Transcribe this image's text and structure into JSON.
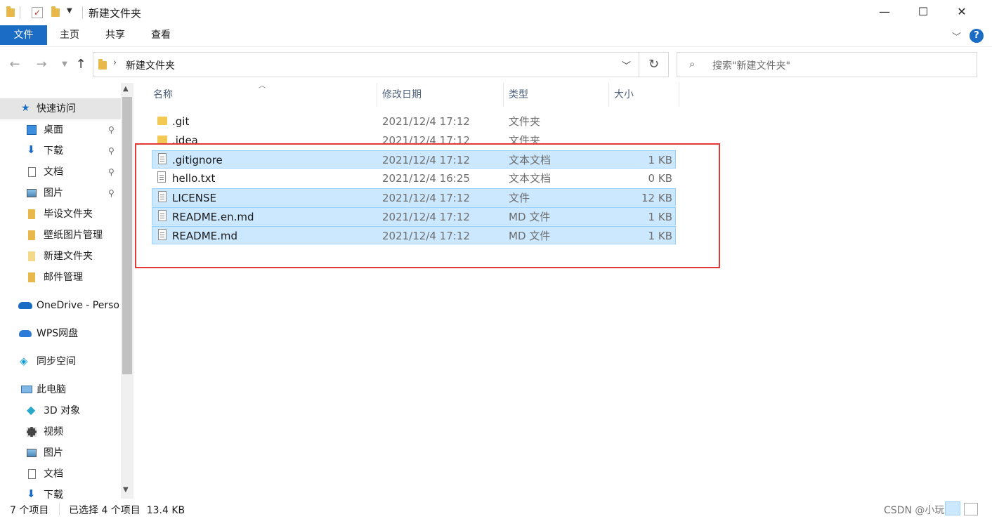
{
  "window": {
    "title": "新建文件夹",
    "controls": {
      "minimize": "—",
      "maximize": "☐",
      "close": "✕"
    }
  },
  "ribbon": {
    "tabs": [
      "文件",
      "主页",
      "共享",
      "查看"
    ],
    "help": "?"
  },
  "address": {
    "path": "新建文件夹",
    "search_placeholder": "搜索\"新建文件夹\""
  },
  "sidebar": {
    "items": [
      {
        "label": "快速访问",
        "icon": "star-icon",
        "selected": true
      },
      {
        "label": "桌面",
        "icon": "desktop-icon",
        "pinned": true
      },
      {
        "label": "下载",
        "icon": "download-icon",
        "pinned": true
      },
      {
        "label": "文档",
        "icon": "document-icon",
        "pinned": true
      },
      {
        "label": "图片",
        "icon": "picture-icon",
        "pinned": true
      },
      {
        "label": "毕设文件夹",
        "icon": "folder-icon"
      },
      {
        "label": "壁纸图片管理",
        "icon": "folder-icon"
      },
      {
        "label": "新建文件夹",
        "icon": "folder-icon"
      },
      {
        "label": "邮件管理",
        "icon": "folder-icon"
      },
      {
        "label": "OneDrive - Perso",
        "icon": "cloud-icon"
      },
      {
        "label": "WPS网盘",
        "icon": "cloud-icon"
      },
      {
        "label": "同步空间",
        "icon": "sync-icon"
      },
      {
        "label": "此电脑",
        "icon": "computer-icon"
      },
      {
        "label": "3D 对象",
        "icon": "cube-icon"
      },
      {
        "label": "视频",
        "icon": "video-icon"
      },
      {
        "label": "图片",
        "icon": "picture-icon"
      },
      {
        "label": "文档",
        "icon": "document-icon"
      },
      {
        "label": "下载",
        "icon": "download-icon"
      }
    ],
    "pin_glyph": "📌"
  },
  "columns": {
    "name": "名称",
    "modified": "修改日期",
    "type": "类型",
    "size": "大小"
  },
  "files": [
    {
      "name": ".git",
      "modified": "2021/12/4 17:12",
      "type": "文件夹",
      "size": "",
      "kind": "folder",
      "selected": false
    },
    {
      "name": ".idea",
      "modified": "2021/12/4 17:12",
      "type": "文件夹",
      "size": "",
      "kind": "folder",
      "selected": false
    },
    {
      "name": ".gitignore",
      "modified": "2021/12/4 17:12",
      "type": "文本文档",
      "size": "1 KB",
      "kind": "doc",
      "selected": true
    },
    {
      "name": "hello.txt",
      "modified": "2021/12/4 16:25",
      "type": "文本文档",
      "size": "0 KB",
      "kind": "doc",
      "selected": false
    },
    {
      "name": "LICENSE",
      "modified": "2021/12/4 17:12",
      "type": "文件",
      "size": "12 KB",
      "kind": "doc",
      "selected": true
    },
    {
      "name": "README.en.md",
      "modified": "2021/12/4 17:12",
      "type": "MD 文件",
      "size": "1 KB",
      "kind": "doc",
      "selected": true
    },
    {
      "name": "README.md",
      "modified": "2021/12/4 17:12",
      "type": "MD 文件",
      "size": "1 KB",
      "kind": "doc",
      "selected": true
    }
  ],
  "status": {
    "count": "7 个项目",
    "selection": "已选择 4 个项目  13.4 KB"
  },
  "watermark": "CSDN @小玩家I",
  "colors": {
    "accent": "#1a6cc4",
    "selection": "#cce8ff",
    "highlight_box": "#e53935"
  }
}
